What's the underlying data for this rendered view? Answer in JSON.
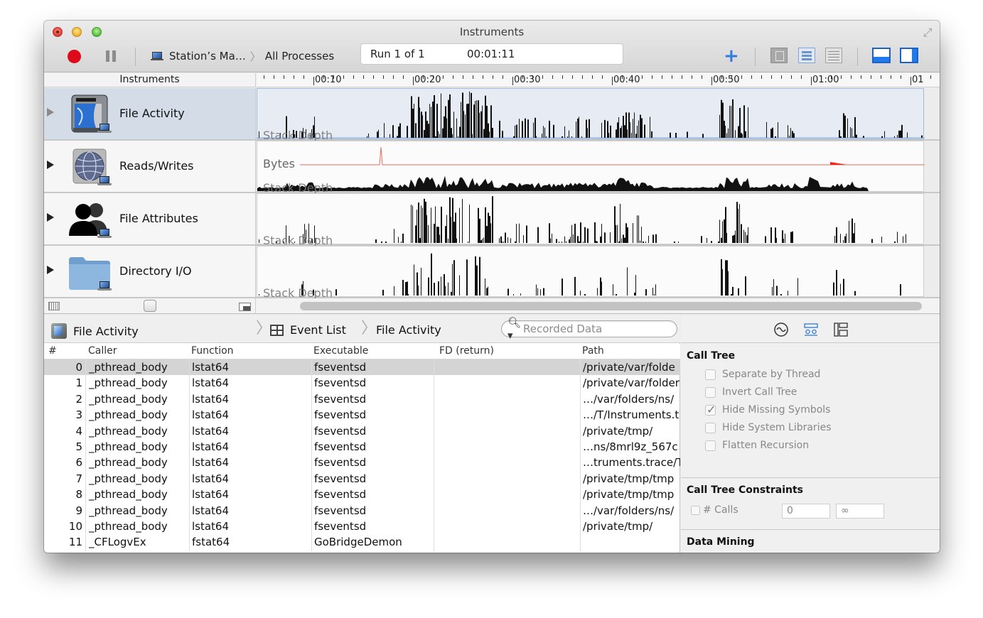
{
  "window": {
    "title": "Instruments"
  },
  "toolbar": {
    "target_device": "Station’s Ma…",
    "target_process": "All Processes",
    "run_label": "Run 1 of 1",
    "run_time": "00:01:11",
    "record_active": true
  },
  "timeline": {
    "header_label": "Instruments",
    "ruler_labels": [
      "00:10",
      "00:20",
      "00:30",
      "00:40",
      "00:50",
      "01:00",
      "01"
    ],
    "tracks": [
      {
        "name": "File Activity",
        "icon": "disk-utility-icon",
        "graph_label": "Stack Depth",
        "selected": true
      },
      {
        "name": "Reads/Writes",
        "icon": "network-globe-icon",
        "graph_label": "Stack Depth",
        "secondary_label": "Bytes",
        "selected": false
      },
      {
        "name": "File Attributes",
        "icon": "users-icon",
        "graph_label": "Stack Depth",
        "selected": false
      },
      {
        "name": "Directory I/O",
        "icon": "folder-icon",
        "graph_label": "Stack Depth",
        "selected": false
      }
    ]
  },
  "detail": {
    "breadcrumb": [
      "File Activity",
      "Event List",
      "File Activity"
    ],
    "search_placeholder": "Recorded Data",
    "columns": [
      "#",
      "Caller",
      "Function",
      "Executable",
      "FD (return)",
      "Path"
    ],
    "rows": [
      {
        "n": "0",
        "caller": "_pthread_body",
        "function": "lstat64",
        "executable": "fseventsd",
        "fd": "",
        "path": "/private/var/folde"
      },
      {
        "n": "1",
        "caller": "_pthread_body",
        "function": "lstat64",
        "executable": "fseventsd",
        "fd": "",
        "path": "/private/var/folder"
      },
      {
        "n": "2",
        "caller": "_pthread_body",
        "function": "lstat64",
        "executable": "fseventsd",
        "fd": "",
        "path": "…/var/folders/ns/"
      },
      {
        "n": "3",
        "caller": "_pthread_body",
        "function": "lstat64",
        "executable": "fseventsd",
        "fd": "",
        "path": "…/T/Instruments.t"
      },
      {
        "n": "4",
        "caller": "_pthread_body",
        "function": "lstat64",
        "executable": "fseventsd",
        "fd": "",
        "path": "/private/tmp/"
      },
      {
        "n": "5",
        "caller": "_pthread_body",
        "function": "lstat64",
        "executable": "fseventsd",
        "fd": "",
        "path": "…ns/8mrl9z_567c"
      },
      {
        "n": "6",
        "caller": "_pthread_body",
        "function": "lstat64",
        "executable": "fseventsd",
        "fd": "",
        "path": "…truments.trace/T"
      },
      {
        "n": "7",
        "caller": "_pthread_body",
        "function": "lstat64",
        "executable": "fseventsd",
        "fd": "",
        "path": "/private/tmp/tmp"
      },
      {
        "n": "8",
        "caller": "_pthread_body",
        "function": "lstat64",
        "executable": "fseventsd",
        "fd": "",
        "path": "/private/tmp/tmp"
      },
      {
        "n": "9",
        "caller": "_pthread_body",
        "function": "lstat64",
        "executable": "fseventsd",
        "fd": "",
        "path": "…/var/folders/ns/"
      },
      {
        "n": "10",
        "caller": "_pthread_body",
        "function": "lstat64",
        "executable": "fseventsd",
        "fd": "",
        "path": "/private/tmp/"
      },
      {
        "n": "11",
        "caller": "_CFLogvEx",
        "function": "fstat64",
        "executable": "GoBridgeDemon",
        "fd": "",
        "path": ""
      }
    ],
    "selected_row": 0
  },
  "inspector": {
    "tabs": [
      "record-settings",
      "display-settings",
      "extended-detail"
    ],
    "active_tab": 1,
    "call_tree": {
      "title": "Call Tree",
      "options": [
        {
          "label": "Separate by Thread",
          "checked": false
        },
        {
          "label": "Invert Call Tree",
          "checked": false
        },
        {
          "label": "Hide Missing Symbols",
          "checked": true
        },
        {
          "label": "Hide System Libraries",
          "checked": false
        },
        {
          "label": "Flatten Recursion",
          "checked": false
        }
      ]
    },
    "constraints": {
      "title": "Call Tree Constraints",
      "calls_label": "# Calls",
      "calls_checked": false,
      "min": "0",
      "max": "∞"
    },
    "data_mining": {
      "title": "Data Mining"
    }
  },
  "colors": {
    "record": "#dd0a1a",
    "accent": "#2e7de1",
    "selected_track": "#d3dce7",
    "bytes_series": "#ef2a1a"
  }
}
